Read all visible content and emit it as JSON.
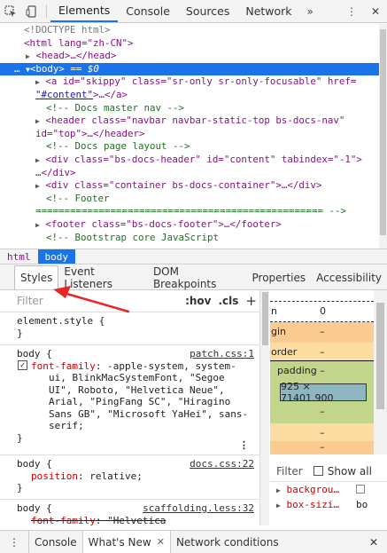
{
  "top_tabs": {
    "tabs": [
      "Elements",
      "Console",
      "Sources",
      "Network"
    ],
    "more": "»",
    "warnings": "⋮",
    "close": "✕"
  },
  "tree": {
    "doctype": "<!DOCTYPE html>",
    "html_open": "<html lang=\"zh-CN\">",
    "head": "<head>…</head>",
    "body_prefix": "…",
    "body_tag": "<body>",
    "body_suffix": " == $0",
    "a_line1": "<a id=\"skippy\" class=\"sr-only sr-only-focusable\" href=",
    "a_line2_link": "\"#content\"",
    "a_line2_rest": ">…</a>",
    "comment1": "<!-- Docs master nav -->",
    "header_line1": "<header class=\"navbar navbar-static-top bs-docs-nav\"",
    "header_line2": "id=\"top\">…</header>",
    "comment2": "<!-- Docs page layout -->",
    "div1_line1": "<div class=\"bs-docs-header\" id=\"content\" tabindex=\"-1\">",
    "div1_line2": "…</div>",
    "div2": "<div class=\"container bs-docs-container\">…</div>",
    "comment3": "<!-- Footer",
    "comment3_rule": "================================================== -->",
    "footer": "<footer class=\"bs-docs-footer\">…</footer>",
    "comment4": "<!-- Bootstrap core JavaScript"
  },
  "breadcrumbs": [
    "html",
    "body"
  ],
  "sub_tabs": [
    "Styles",
    "Event Listeners",
    "DOM Breakpoints",
    "Properties",
    "Accessibility"
  ],
  "styles_filter": {
    "placeholder": "Filter",
    "hov": ":hov",
    "cls": ".cls",
    "add": "+"
  },
  "rules": {
    "element_style": "element.style {",
    "close": "}",
    "r1_selector": "body {",
    "r1_source": "patch.css:1",
    "r1_prop": "font-family",
    "r1_lines": [
      ": -apple-system, system-",
      "ui, BlinkMacSystemFont, \"Segoe",
      "UI\", Roboto, \"Helvetica Neue\",",
      "Arial, \"PingFang SC\", \"Hiragino",
      "Sans GB\", \"Microsoft YaHei\", sans-",
      "serif;"
    ],
    "r2_selector": "body {",
    "r2_source": "docs.css:22",
    "r2_prop": "position",
    "r2_value": ": relative;",
    "r3_selector": "body {",
    "r3_source": "scaffolding.less:32",
    "r3_prop": "font-family",
    "r3_value": ": \"Helvetica"
  },
  "box_model": {
    "margin_label": "n",
    "margin_value": "0",
    "border_label": "gin",
    "border_value": "–",
    "border2_label": "order",
    "border2_value": "–",
    "padding_label": "padding –",
    "content": "925 × 71401.900",
    "dash": "–"
  },
  "computed": {
    "filter": "Filter",
    "show_all": "Show all",
    "rows": [
      {
        "prop": "backgrou…",
        "value": ""
      },
      {
        "prop": "box-sizi…",
        "value": "bo"
      }
    ]
  },
  "drawer": {
    "menu": "⋮",
    "tabs": [
      "Console",
      "What's New",
      "Network conditions"
    ],
    "close": "✕"
  },
  "colors": {
    "accent": "#1a73e8",
    "annotation_arrow": "#e8262a",
    "margin_orange": "#fccb8f",
    "padding_green": "#c2d58a",
    "content_blue": "#8cb6c0"
  }
}
